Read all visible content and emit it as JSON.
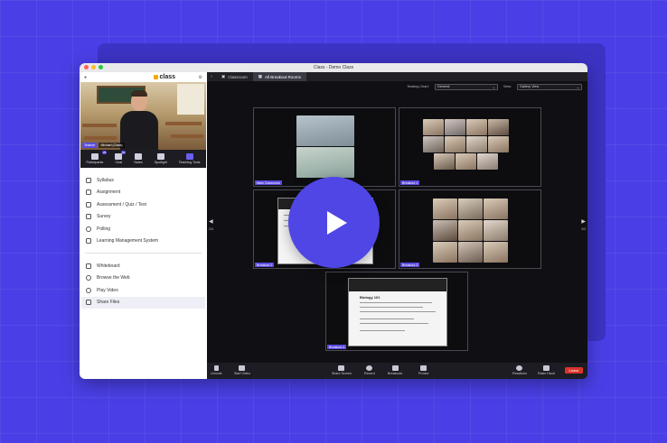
{
  "window": {
    "title": "Class - Demo Class"
  },
  "brand": {
    "name": "class"
  },
  "video": {
    "badge": "Teacher",
    "name": "Michael (Class)"
  },
  "quick_bar": [
    {
      "label": "Participants",
      "badge": "25",
      "icon": "participants-icon"
    },
    {
      "label": "Chat",
      "badge": "10",
      "icon": "chat-icon"
    },
    {
      "label": "Notes",
      "badge": "",
      "icon": "notes-icon"
    },
    {
      "label": "Spotlight",
      "badge": "",
      "icon": "spotlight-icon"
    },
    {
      "label": "Teaching Tools",
      "badge": "",
      "icon": "teaching-tools-icon"
    }
  ],
  "menu": {
    "group1": [
      {
        "label": "Syllabus",
        "icon": "syllabus-icon"
      },
      {
        "label": "Assignment",
        "icon": "assignment-icon"
      },
      {
        "label": "Assessment / Quiz / Test",
        "icon": "assessment-icon"
      },
      {
        "label": "Survey",
        "icon": "survey-icon"
      },
      {
        "label": "Polling",
        "icon": "polling-icon"
      },
      {
        "label": "Learning Management System",
        "icon": "lms-icon"
      }
    ],
    "group2": [
      {
        "label": "Whiteboard",
        "icon": "whiteboard-icon"
      },
      {
        "label": "Browse the Web",
        "icon": "globe-icon"
      },
      {
        "label": "Play Video",
        "icon": "play-video-icon"
      },
      {
        "label": "Share Files",
        "icon": "folder-icon"
      }
    ]
  },
  "tabs": [
    {
      "label": "Classroom"
    },
    {
      "label": "All Breakout Rooms"
    }
  ],
  "toolbar": {
    "seating_label": "Seating Chart:",
    "seating_value": "General",
    "view_label": "View:",
    "view_value": "Gallery View"
  },
  "rooms": [
    {
      "label": "Main Classroom"
    },
    {
      "label": "Breakout 1"
    },
    {
      "label": "Breakout 2"
    },
    {
      "label": "Breakout 3"
    },
    {
      "label": "Breakout 4"
    }
  ],
  "shared_doc": {
    "title": "Biology 101"
  },
  "pager": {
    "left": "2/3",
    "right": "3/3"
  },
  "bottom_bar": {
    "unmute": "Unmute",
    "start_video": "Start Video",
    "share_screen": "Share Screen",
    "record": "Record",
    "breakouts": "Breakouts",
    "proctor": "Proctor",
    "reactions": "Reactions",
    "raise_hand": "Raise Hand",
    "leave": "Leave"
  },
  "colors": {
    "accent": "#5b4be0",
    "background": "#4a3fe6",
    "leave": "#d9342b"
  }
}
